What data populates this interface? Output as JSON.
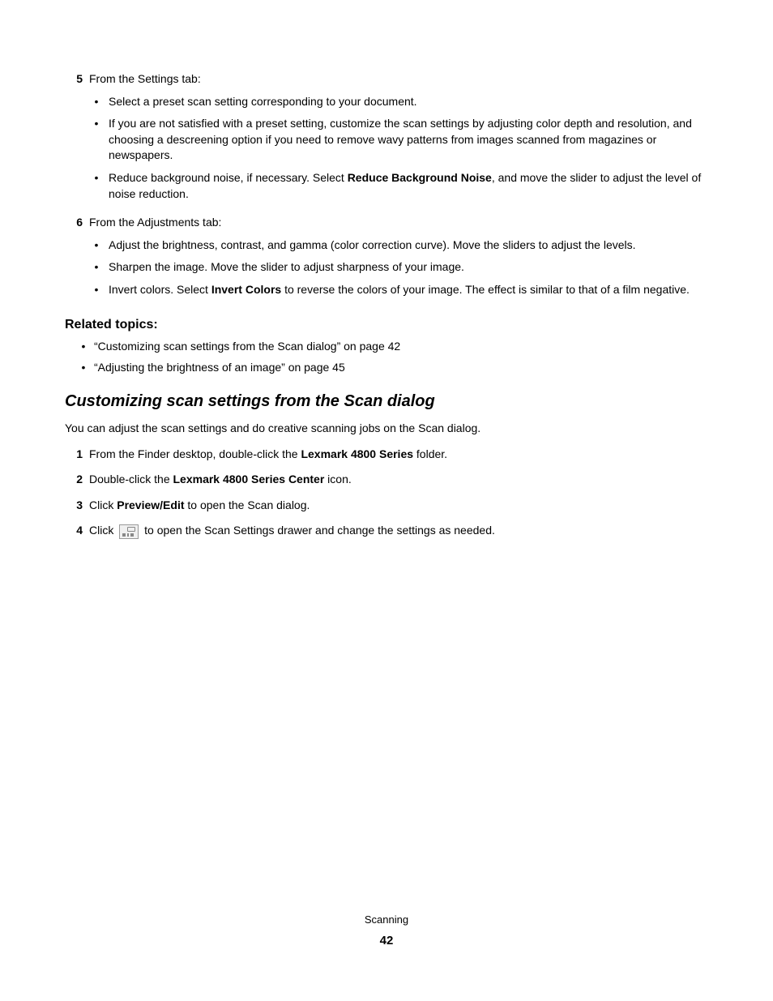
{
  "step5": {
    "num": "5",
    "intro": "From the Settings tab:",
    "bullets": [
      {
        "text": "Select a preset scan setting corresponding to your document."
      },
      {
        "text": "If you are not satisfied with a preset setting, customize the scan settings by adjusting color depth and resolution, and choosing a descreening option if you need to remove wavy patterns from images scanned from magazines or newspapers."
      },
      {
        "prefix": "Reduce background noise, if necessary. Select ",
        "bold": "Reduce Background Noise",
        "suffix": ", and move the slider to adjust the level of noise reduction."
      }
    ]
  },
  "step6": {
    "num": "6",
    "intro": "From the Adjustments tab:",
    "bullets": [
      {
        "text": "Adjust the brightness, contrast, and gamma (color correction curve). Move the sliders to adjust the levels."
      },
      {
        "text": "Sharpen the image. Move the slider to adjust sharpness of your image."
      },
      {
        "prefix": "Invert colors. Select ",
        "bold": "Invert Colors",
        "suffix": " to reverse the colors of your image. The effect is similar to that of a film negative."
      }
    ]
  },
  "related": {
    "heading": "Related topics:",
    "items": [
      "“Customizing scan settings from the Scan dialog” on page 42",
      "“Adjusting the brightness of an image” on page 45"
    ]
  },
  "section": {
    "heading": "Customizing scan settings from the Scan dialog",
    "intro": "You can adjust the scan settings and do creative scanning jobs on the Scan dialog.",
    "steps": {
      "s1": {
        "num": "1",
        "prefix": "From the Finder desktop, double-click the ",
        "bold": "Lexmark 4800 Series",
        "suffix": " folder."
      },
      "s2": {
        "num": "2",
        "prefix": "Double-click the ",
        "bold": "Lexmark 4800 Series Center",
        "suffix": " icon."
      },
      "s3": {
        "num": "3",
        "prefix": "Click ",
        "bold": "Preview/Edit",
        "suffix": " to open the Scan dialog."
      },
      "s4": {
        "num": "4",
        "prefix": "Click ",
        "suffix": " to open the Scan Settings drawer and change the settings as needed."
      }
    }
  },
  "footer": {
    "label": "Scanning",
    "page": "42"
  }
}
